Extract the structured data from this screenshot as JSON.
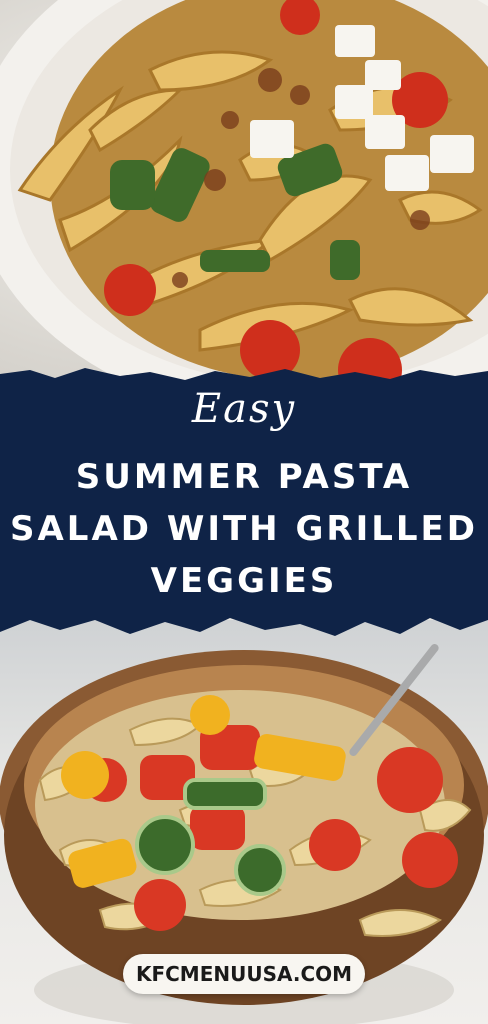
{
  "banner": {
    "script_word": "Easy",
    "headline_lines": [
      "SUMMER PASTA",
      "SALAD WITH GRILLED",
      "VEGGIES"
    ],
    "background_color": "#0f2347",
    "text_color": "#ffffff"
  },
  "photos": [
    {
      "subject": "plate of rotini pasta with grilled zucchini, tomatoes and feta"
    },
    {
      "subject": "wooden bowl of rotini pasta salad with tomatoes, zucchini and peppers"
    }
  ],
  "footer": {
    "site_label": "KFCMENUUSA.COM"
  }
}
